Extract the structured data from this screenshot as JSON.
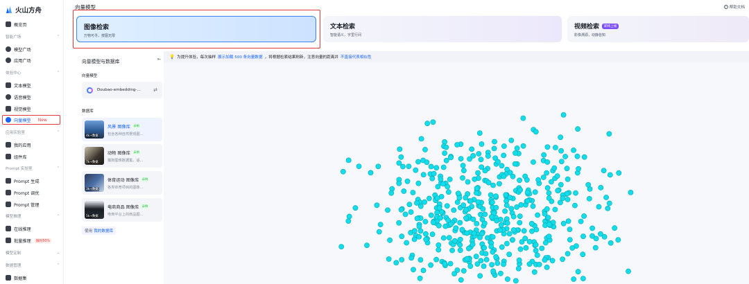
{
  "brand": {
    "name": "火山方舟"
  },
  "sidebar": {
    "overview": "概览页",
    "sections": [
      {
        "label": "智能广场",
        "items": [
          "模型广场",
          "应用广场"
        ]
      },
      {
        "label": "体验中心",
        "items": [
          "文本模型",
          "语音模型",
          "视觉模型",
          "向量模型"
        ]
      },
      {
        "label": "应用实验室",
        "items": [
          "我的应用",
          "组件库"
        ]
      },
      {
        "label": "Prompt 实验室",
        "items": [
          "Prompt 生成",
          "Prompt 调优",
          "Prompt 管理"
        ]
      },
      {
        "label": "模型推理",
        "items": [
          "在线推理",
          "批量推理"
        ]
      },
      {
        "label": "模型定制",
        "items": []
      },
      {
        "label": "数据管理",
        "items": [
          "数据集"
        ]
      }
    ],
    "active_item": "向量模型",
    "new_tag": "New",
    "discount_tag": "限时50%"
  },
  "header": {
    "title": "向量模型",
    "help": "帮助文档"
  },
  "cards": [
    {
      "title": "图像检索",
      "subtitle": "万物可寻，按图无限",
      "selected": true
    },
    {
      "title": "文本检索",
      "subtitle": "智能语义，字里行间",
      "selected": false
    },
    {
      "title": "视频检索",
      "subtitle": "影像溯源，动静皆知",
      "badge": "即将上线",
      "selected": false
    }
  ],
  "panel": {
    "title": "向量模型与数据库",
    "model_label": "向量模型",
    "model_name": "Doubao-embedding-...",
    "db_label": "数据库",
    "databases": [
      {
        "name": "风景 图像库",
        "tag": "示例",
        "desc": "包含各种自然景观图...",
        "count": "4k+数据",
        "selected": true
      },
      {
        "name": "动物 图像库",
        "tag": "示例",
        "desc": "猫狗图像数据集，适...",
        "count": "7k+数据",
        "selected": false
      },
      {
        "name": "体育运动 图像库",
        "tag": "示例",
        "desc": "各类体育项目的图像...",
        "count": "3k+数据",
        "selected": false
      },
      {
        "name": "电商商品 图像库",
        "tag": "示例",
        "desc": "电商平台上的商品图...",
        "count": "5k+数据",
        "selected": false
      }
    ],
    "use_mine_prefix": "使用",
    "use_mine_link": "我的数据库"
  },
  "notice": {
    "prefix": "为提升体验，每次抽样",
    "link1": "展示加载 500 条向量数据",
    "middle": "，将根据检索结果刷新，注意向量的距离并",
    "link2": "不直接代表相似性"
  },
  "colors": {
    "accent": "#1664ff",
    "point": "#12ddea",
    "highlight": "#e23a3a"
  }
}
